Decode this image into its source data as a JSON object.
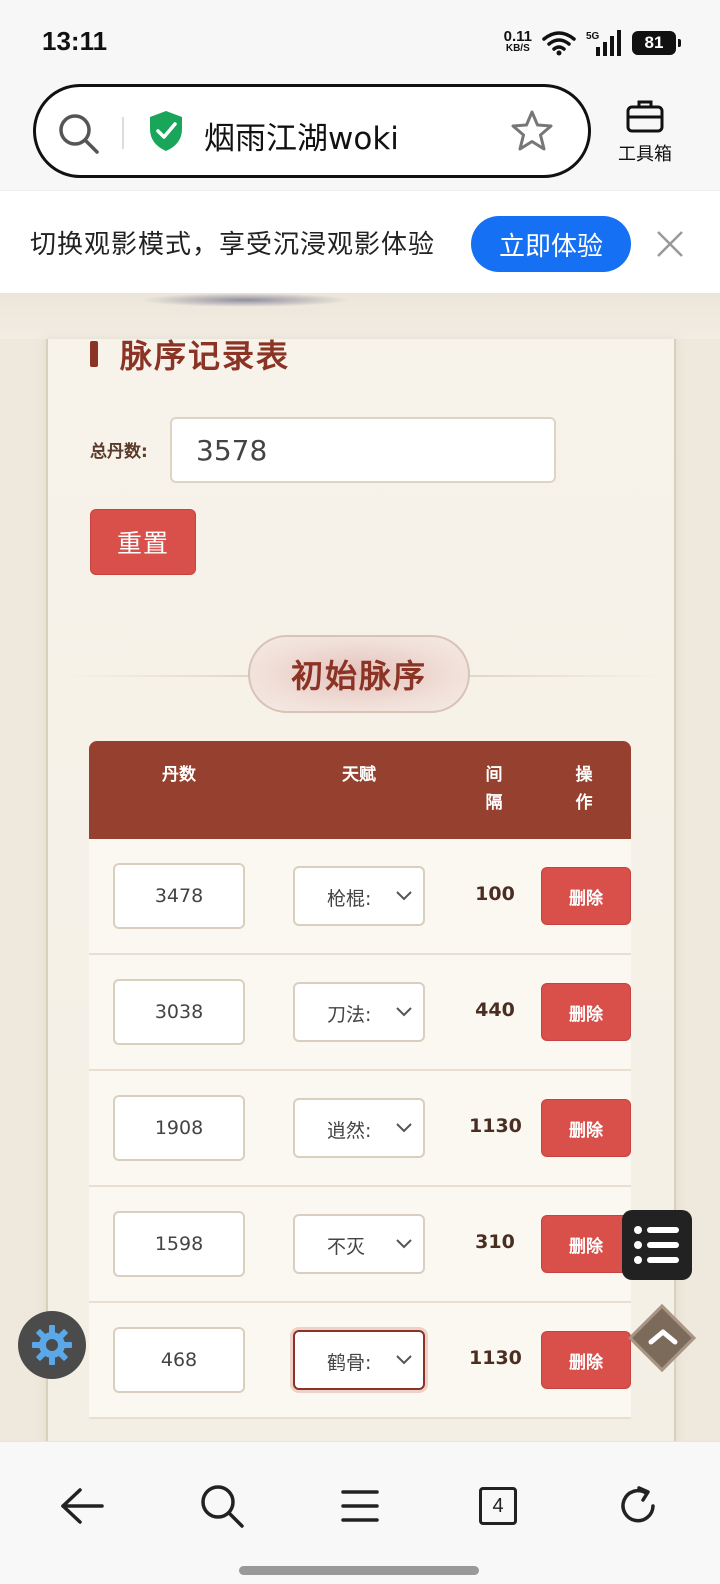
{
  "status_bar": {
    "time": "13:11",
    "net_speed_value": "0.11",
    "net_speed_unit": "KB/S",
    "battery": "81"
  },
  "browser": {
    "url_title": "烟雨江湖woki",
    "toolbox_label": "工具箱"
  },
  "banner": {
    "text": "切换观影模式，享受沉浸观影体验",
    "button_label": "立即体验"
  },
  "page": {
    "section_title": "脉序记录表",
    "total_label": "总丹数:",
    "total_value": "3578",
    "reset_label": "重置",
    "initial_title": "初始脉序",
    "table": {
      "headers": {
        "dan": "丹数",
        "tian": "天赋",
        "jian": "间隔",
        "cao": "操作"
      },
      "rows": [
        {
          "dan": "3478",
          "tian": "枪棍:",
          "jian": "100",
          "del": "删除"
        },
        {
          "dan": "3038",
          "tian": "刀法:",
          "jian": "440",
          "del": "删除"
        },
        {
          "dan": "1908",
          "tian": "逍然:",
          "jian": "1130",
          "del": "删除"
        },
        {
          "dan": "1598",
          "tian": "不灭",
          "jian": "310",
          "del": "删除"
        },
        {
          "dan": "468",
          "tian": "鹤骨:",
          "jian": "1130",
          "del": "删除"
        }
      ]
    }
  },
  "bottom_nav": {
    "tabs_count": "4"
  },
  "colors": {
    "accent_red": "#d94f4a",
    "table_header": "#96412f",
    "title_red": "#8b3324",
    "banner_blue": "#1570f3"
  }
}
